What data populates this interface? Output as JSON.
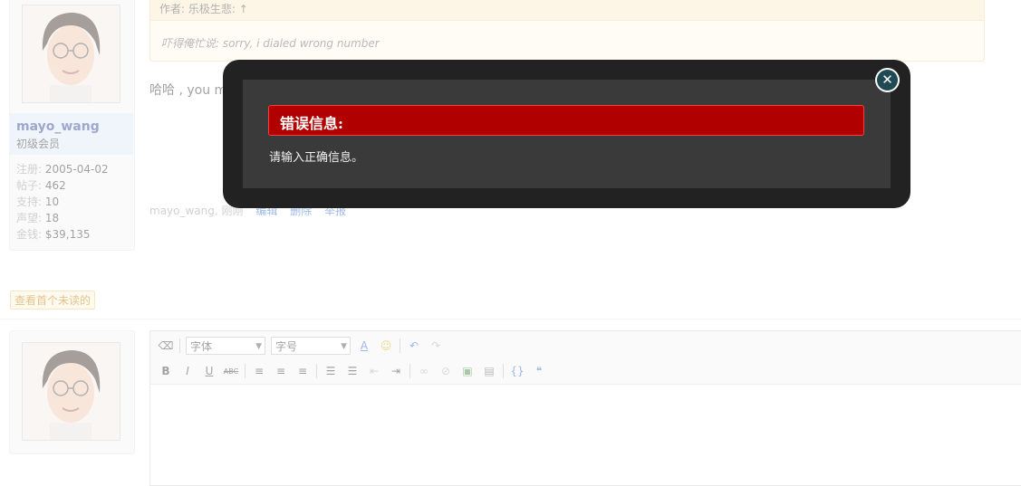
{
  "post": {
    "quote_author": "作者: 乐极生悲: ↑",
    "quote_text": "吓得俺忙说: sorry, i dialed wrong number",
    "body": "哈哈 ,  you made my day. 那然后呢？",
    "footer_author": "mayo_wang, 刚刚",
    "footer_edit": "编辑",
    "footer_delete": "删除",
    "footer_report": "举报"
  },
  "user": {
    "name": "mayo_wang",
    "rank": "初级会员",
    "stats": [
      {
        "label": "注册:",
        "value": "2005-04-02"
      },
      {
        "label": "帖子:",
        "value": "462"
      },
      {
        "label": "支持:",
        "value": "10"
      },
      {
        "label": "声望:",
        "value": "18"
      },
      {
        "label": "金钱:",
        "value": "$39,135"
      }
    ]
  },
  "unread_button": "查看首个未读的",
  "editor": {
    "font_select": "字体",
    "size_select": "字号",
    "icons_row1": [
      "eraser-icon",
      "font-color-icon",
      "smiley-icon",
      "undo-icon",
      "redo-icon"
    ],
    "icons_row2": [
      "bold-icon",
      "italic-icon",
      "underline-icon",
      "strikethrough-icon",
      "align-left-icon",
      "align-center-icon",
      "align-right-icon",
      "bullet-list-icon",
      "numbered-list-icon",
      "outdent-icon",
      "indent-icon",
      "link-icon",
      "unlink-icon",
      "image-icon",
      "media-icon",
      "code-icon",
      "quote-icon"
    ]
  },
  "dialog": {
    "title": "错误信息:",
    "message": "请输入正确信息。",
    "colors": {
      "header": "#b00000",
      "frame": "#222222",
      "inner": "#3a3a3a"
    }
  }
}
